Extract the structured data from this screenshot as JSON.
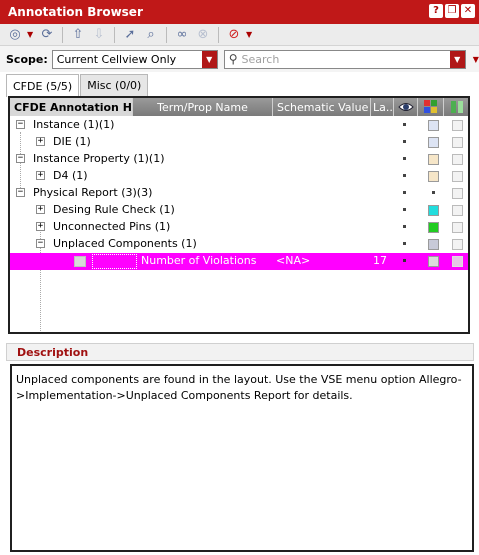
{
  "window": {
    "title": "Annotation Browser",
    "buttons": [
      "?",
      "❐",
      "✕"
    ]
  },
  "scope": {
    "label": "Scope:",
    "value": "Current Cellview Only",
    "search_placeholder": "Search"
  },
  "tabs": [
    {
      "label": "CFDE (5/5)",
      "active": true
    },
    {
      "label": "Misc (0/0)",
      "active": false
    }
  ],
  "columns": [
    "CFDE Annotation Hier...",
    "Term/Prop Name",
    "Schematic Value",
    "La..."
  ],
  "tree": [
    {
      "label": "Instance (1)(1)",
      "expander": "−",
      "swatch": "#dde4f4"
    },
    {
      "label": "DIE (1)",
      "expander": "+",
      "swatch": "#dde4f4"
    },
    {
      "label": "Instance Property (1)(1)",
      "expander": "−",
      "swatch": "#f6e6c8"
    },
    {
      "label": "D4 (1)",
      "expander": "+",
      "swatch": "#f6e6c8"
    },
    {
      "label": "Physical Report (3)(3)",
      "expander": "−",
      "swatch": ""
    },
    {
      "label": "Desing Rule Check (1)",
      "expander": "+",
      "swatch": "#22dddd"
    },
    {
      "label": "Unconnected Pins (1)",
      "expander": "+",
      "swatch": "#22cc22"
    },
    {
      "label": "Unplaced Components (1)",
      "expander": "−",
      "swatch": "#c8cad8"
    }
  ],
  "selected_row": {
    "term": "Number of Violations",
    "value": "<NA>",
    "layer": "17"
  },
  "description": {
    "title": "Description",
    "text": "Unplaced components are found in the layout. Use the VSE menu option Allegro->Implementation->Unplaced Components Report for details."
  },
  "colors": {
    "titlebar": "#c01818",
    "selection": "#ff00ff",
    "accent_red": "#b01818"
  }
}
